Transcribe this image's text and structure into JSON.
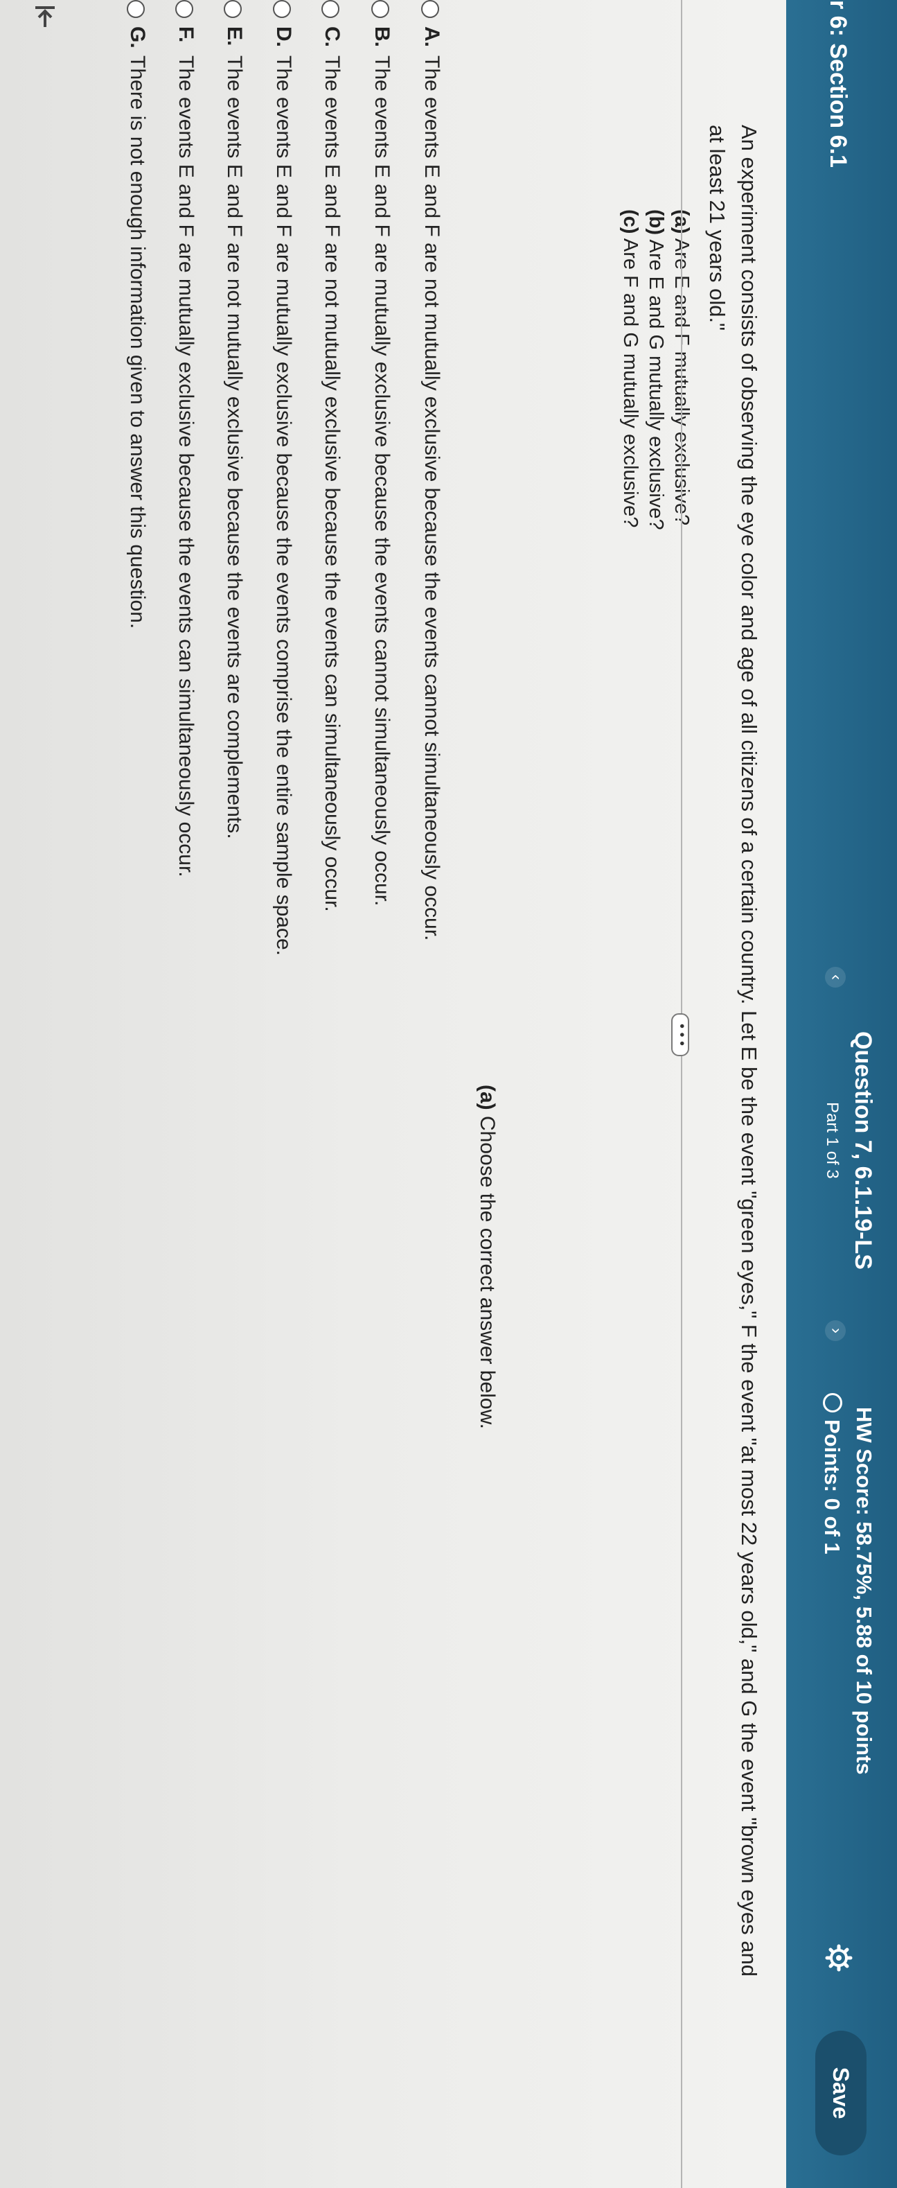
{
  "header": {
    "section_title": "r 6: Section 6.1",
    "prev_glyph": "‹",
    "next_glyph": "›",
    "question_title": "Question 7, 6.1.19-LS",
    "part_label": "Part 1 of 3",
    "hw_score": "HW Score: 58.75%, 5.88 of 10 points",
    "points": "Points: 0 of 1",
    "save_label": "Save",
    "gear_icon": "gear-icon"
  },
  "collapse_glyph": "• • •",
  "back_icon": "collapse-arrow-icon",
  "question": {
    "line1": "An experiment consists of observing the eye color and age of all citizens of a certain country. Let E be the event \"green eyes,\" F the event \"at most 22 years old,\" and G the event \"brown eyes and",
    "line2": "at least 21 years old.\"",
    "parts": [
      {
        "label": "(a)",
        "text": "Are E and F mutually exclusive?"
      },
      {
        "label": "(b)",
        "text": "Are E and G mutually exclusive?"
      },
      {
        "label": "(c)",
        "text": "Are F and G mutually exclusive?"
      }
    ]
  },
  "answer_area": {
    "prompt_label": "(a)",
    "prompt_text": "Choose the correct answer below.",
    "choices": [
      {
        "letter": "A.",
        "text": "The events E and F are not mutually exclusive because the events cannot simultaneously occur."
      },
      {
        "letter": "B.",
        "text": "The events E and F are mutually exclusive because the events cannot simultaneously occur."
      },
      {
        "letter": "C.",
        "text": "The events E and F are not mutually exclusive because the events can simultaneously occur."
      },
      {
        "letter": "D.",
        "text": "The events E and F are mutually exclusive because the events comprise the entire sample space."
      },
      {
        "letter": "E.",
        "text": "The events E and F are not mutually exclusive because the events are complements."
      },
      {
        "letter": "F.",
        "text": "The events E and F are mutually exclusive because the events can simultaneously occur."
      },
      {
        "letter": "G.",
        "text": "There is not enough information given to answer this question."
      }
    ]
  }
}
